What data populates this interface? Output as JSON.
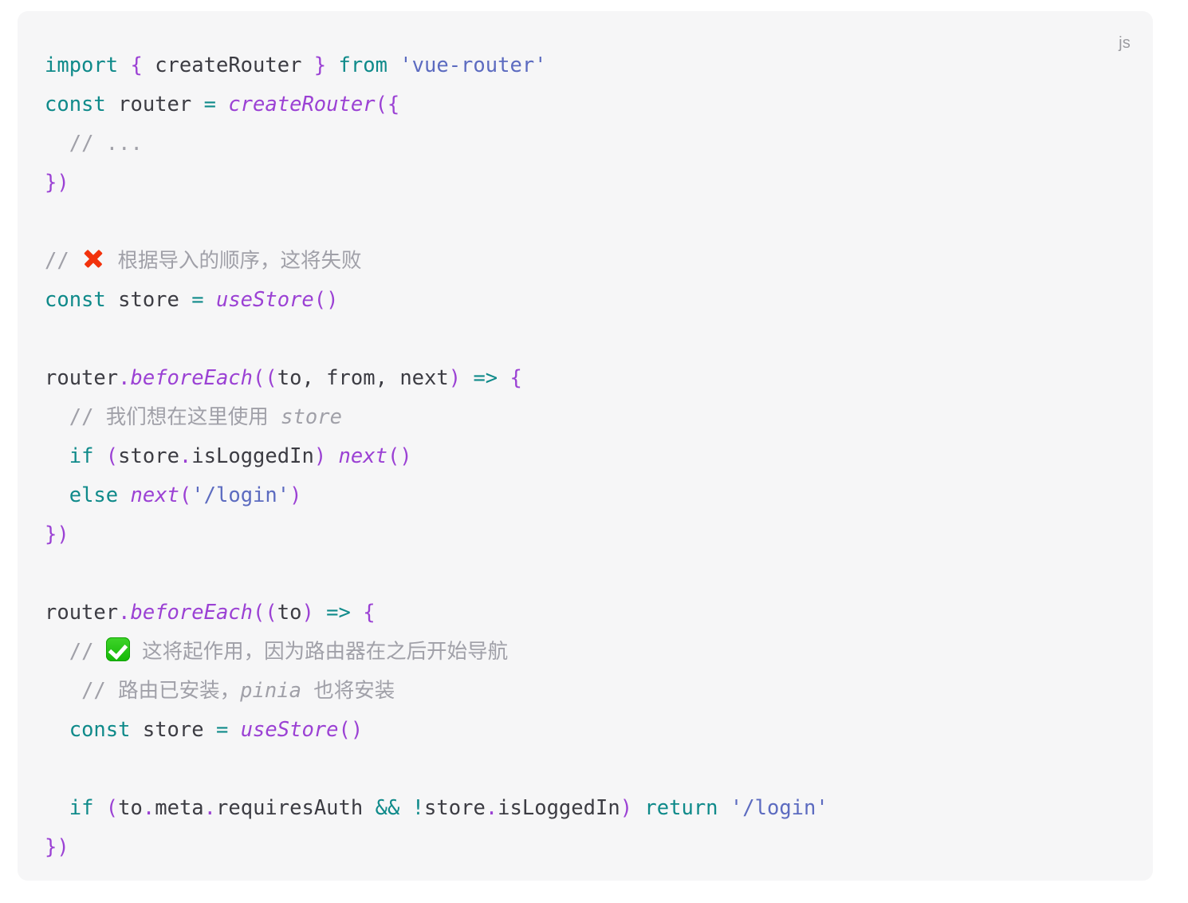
{
  "code_block": {
    "language_label": "js",
    "language": "javascript",
    "background_color": "#f6f6f7",
    "colors": {
      "keyword": "#0f8a8a",
      "punctuation": "#9b41d4",
      "function": "#9b41d4",
      "string": "#5c6bc0",
      "identifier": "#3c3c43",
      "comment": "#a0a0a8",
      "emoji_cross": "#f2320c",
      "emoji_check": "#14b806"
    },
    "lines": [
      {
        "n": 1,
        "text": "import { createRouter } from 'vue-router'"
      },
      {
        "n": 2,
        "text": "const router = createRouter({"
      },
      {
        "n": 3,
        "text": "  // ..."
      },
      {
        "n": 4,
        "text": "})"
      },
      {
        "n": 5,
        "text": ""
      },
      {
        "n": 6,
        "text": "// ❌ 根据导入的顺序，这将失败"
      },
      {
        "n": 7,
        "text": "const store = useStore()"
      },
      {
        "n": 8,
        "text": ""
      },
      {
        "n": 9,
        "text": "router.beforeEach((to, from, next) => {"
      },
      {
        "n": 10,
        "text": "  // 我们想在这里使用 store"
      },
      {
        "n": 11,
        "text": "  if (store.isLoggedIn) next()"
      },
      {
        "n": 12,
        "text": "  else next('/login')"
      },
      {
        "n": 13,
        "text": "})"
      },
      {
        "n": 14,
        "text": ""
      },
      {
        "n": 15,
        "text": "router.beforeEach((to) => {"
      },
      {
        "n": 16,
        "text": "  // ✅ 这将起作用，因为路由器在之后开始导航"
      },
      {
        "n": 17,
        "text": "   // 路由已安装，pinia 也将安装"
      },
      {
        "n": 18,
        "text": "  const store = useStore()"
      },
      {
        "n": 19,
        "text": ""
      },
      {
        "n": 20,
        "text": "  if (to.meta.requiresAuth && !store.isLoggedIn) return '/login'"
      },
      {
        "n": 21,
        "text": "})"
      }
    ],
    "tokens": {
      "kw_import": "import",
      "kw_from": "from",
      "kw_const": "const",
      "kw_if": "if",
      "kw_else": "else",
      "kw_return": "return",
      "str_vue_router": "'vue-router'",
      "str_login": "'/login'",
      "id_createRouter": "createRouter",
      "id_router": "router",
      "id_store": "store",
      "id_useStore": "useStore",
      "id_beforeEach": "beforeEach",
      "id_next": "next",
      "id_to": "to",
      "id_from": "from",
      "id_meta": "meta",
      "id_requiresAuth": "requiresAuth",
      "id_isLoggedIn": "isLoggedIn",
      "comment_dots": "// ...",
      "comment_fail": "根据导入的顺序，这将失败",
      "comment_use_store_here": "我们想在这里使用",
      "comment_store_word": "store",
      "comment_works": "这将起作用，因为路由器在之后开始导航",
      "comment_router_installed": "路由已安装，",
      "comment_pinia": "pinia",
      "comment_also_installed": "也将安装",
      "slashes": "//",
      "arrow": "=>",
      "and_and": "&&",
      "bang": "!",
      "equals": "=",
      "dot": ".",
      "comma": ",",
      "open_brace": "{",
      "close_brace": "}",
      "open_paren": "(",
      "close_paren": ")",
      "close_paren_brace": "})",
      "open_paren_brace": "({",
      "double_open_paren": "((",
      "empty_parens": "()"
    }
  }
}
